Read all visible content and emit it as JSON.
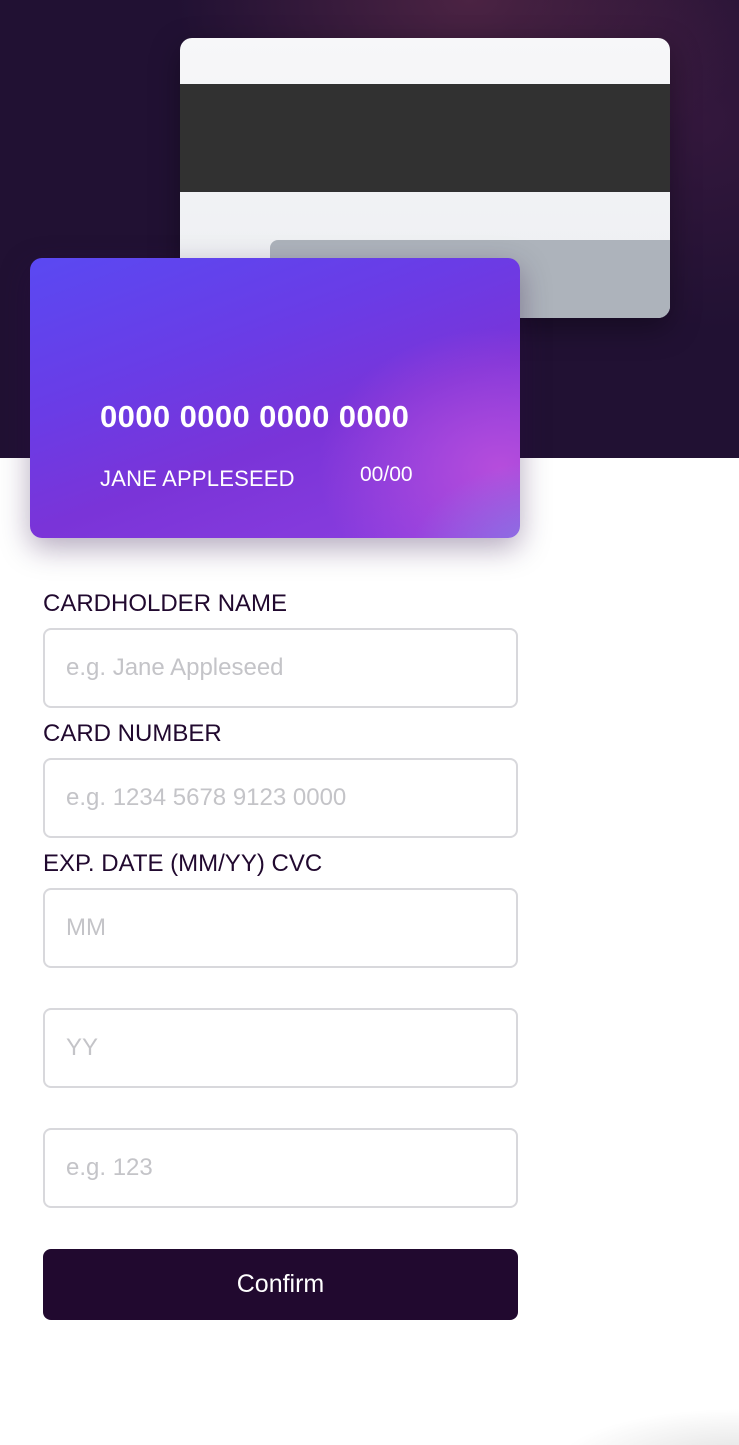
{
  "card_preview": {
    "number": "0000 0000 0000 0000",
    "name": "JANE APPLESEED",
    "expiry": "00/00"
  },
  "form": {
    "cardholder_label": "CARDHOLDER NAME",
    "cardholder_placeholder": "e.g. Jane Appleseed",
    "number_label": "CARD NUMBER",
    "number_placeholder": "e.g. 1234 5678 9123 0000",
    "exp_label": "EXP. DATE (MM/YY) CVC",
    "month_placeholder": "MM",
    "year_placeholder": "YY",
    "cvc_placeholder": "e.g. 123",
    "confirm_label": "Confirm"
  },
  "colors": {
    "dark_violet": "#21092f",
    "gradient_start": "#6348fe",
    "gradient_end": "#610595",
    "input_border": "#d8d8dc"
  }
}
